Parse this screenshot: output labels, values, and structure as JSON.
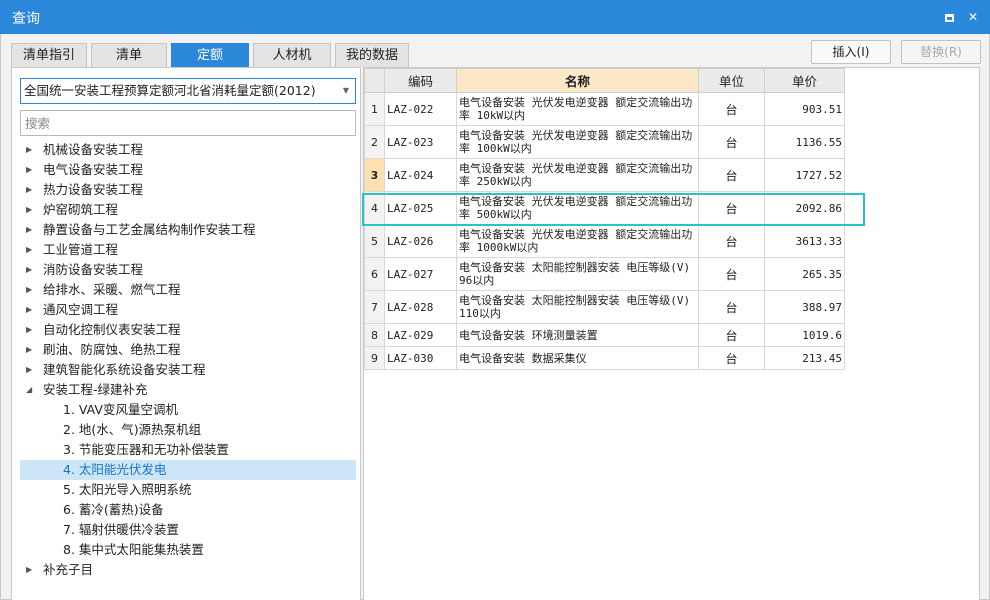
{
  "window": {
    "title": "查询"
  },
  "tabs": [
    {
      "label": "清单指引",
      "active": false
    },
    {
      "label": "清单",
      "active": false
    },
    {
      "label": "定额",
      "active": true
    },
    {
      "label": "人材机",
      "active": false
    },
    {
      "label": "我的数据",
      "active": false
    }
  ],
  "toolbar": {
    "insert_label": "插入(I)",
    "replace_label": "替换(R)"
  },
  "left": {
    "quota_library": "全国统一安装工程预算定额河北省消耗量定额(2012)",
    "search_placeholder": "搜索",
    "tree": [
      {
        "label": "机械设备安装工程",
        "level": 0,
        "expanded": false
      },
      {
        "label": "电气设备安装工程",
        "level": 0,
        "expanded": false
      },
      {
        "label": "热力设备安装工程",
        "level": 0,
        "expanded": false
      },
      {
        "label": "炉窑砌筑工程",
        "level": 0,
        "expanded": false
      },
      {
        "label": "静置设备与工艺金属结构制作安装工程",
        "level": 0,
        "expanded": false
      },
      {
        "label": "工业管道工程",
        "level": 0,
        "expanded": false
      },
      {
        "label": "消防设备安装工程",
        "level": 0,
        "expanded": false
      },
      {
        "label": "给排水、采暖、燃气工程",
        "level": 0,
        "expanded": false
      },
      {
        "label": "通风空调工程",
        "level": 0,
        "expanded": false
      },
      {
        "label": "自动化控制仪表安装工程",
        "level": 0,
        "expanded": false
      },
      {
        "label": "刷油、防腐蚀、绝热工程",
        "level": 0,
        "expanded": false
      },
      {
        "label": "建筑智能化系统设备安装工程",
        "level": 0,
        "expanded": false
      },
      {
        "label": "安装工程-绿建补充",
        "level": 0,
        "expanded": true
      },
      {
        "label": "1. VAV变风量空调机",
        "level": 1
      },
      {
        "label": "2. 地(水、气)源热泵机组",
        "level": 1
      },
      {
        "label": "3. 节能变压器和无功补偿装置",
        "level": 1
      },
      {
        "label": "4. 太阳能光伏发电",
        "level": 1,
        "selected": true
      },
      {
        "label": "5. 太阳光导入照明系统",
        "level": 1
      },
      {
        "label": "6. 蓄冷(蓄热)设备",
        "level": 1
      },
      {
        "label": "7. 辐射供暖供冷装置",
        "level": 1
      },
      {
        "label": "8. 集中式太阳能集热装置",
        "level": 1
      },
      {
        "label": "补充子目",
        "level": 0,
        "expanded": false
      }
    ]
  },
  "grid": {
    "headers": {
      "code": "编码",
      "name": "名称",
      "unit": "单位",
      "price": "单价"
    },
    "rows": [
      {
        "idx": "1",
        "code": "LAZ-022",
        "name": "电气设备安装 光伏发电逆变器 额定交流输出功率 10kW以内",
        "unit": "台",
        "price": "903.51"
      },
      {
        "idx": "2",
        "code": "LAZ-023",
        "name": "电气设备安装 光伏发电逆变器 额定交流输出功率 100kW以内",
        "unit": "台",
        "price": "1136.55"
      },
      {
        "idx": "3",
        "code": "LAZ-024",
        "name": "电气设备安装 光伏发电逆变器 额定交流输出功率 250kW以内",
        "unit": "台",
        "price": "1727.52",
        "selected": true
      },
      {
        "idx": "4",
        "code": "LAZ-025",
        "name": "电气设备安装 光伏发电逆变器 额定交流输出功率 500kW以内",
        "unit": "台",
        "price": "2092.86"
      },
      {
        "idx": "5",
        "code": "LAZ-026",
        "name": "电气设备安装 光伏发电逆变器 额定交流输出功率 1000kW以内",
        "unit": "台",
        "price": "3613.33"
      },
      {
        "idx": "6",
        "code": "LAZ-027",
        "name": "电气设备安装 太阳能控制器安装 电压等级(V) 96以内",
        "unit": "台",
        "price": "265.35"
      },
      {
        "idx": "7",
        "code": "LAZ-028",
        "name": "电气设备安装 太阳能控制器安装 电压等级(V) 110以内",
        "unit": "台",
        "price": "388.97"
      },
      {
        "idx": "8",
        "code": "LAZ-029",
        "name": "电气设备安装 环境测量装置",
        "unit": "台",
        "price": "1019.6"
      },
      {
        "idx": "9",
        "code": "LAZ-030",
        "name": "电气设备安装 数据采集仪",
        "unit": "台",
        "price": "213.45"
      }
    ]
  },
  "colors": {
    "accent": "#2b87da",
    "selection_outline": "#2bc2c2",
    "name_header": "#fbe8c8"
  }
}
